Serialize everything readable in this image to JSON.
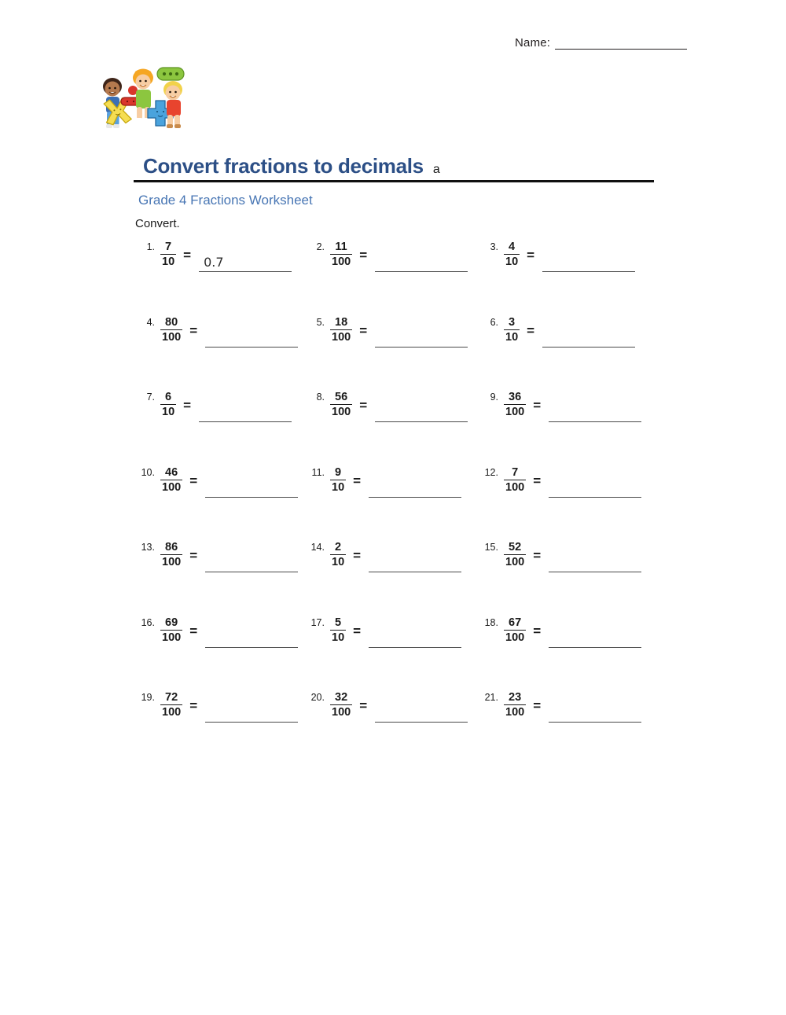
{
  "header": {
    "name_label": "Name:",
    "name_value": ""
  },
  "title": {
    "main": "Convert fractions to decimals",
    "variant": "a",
    "subtitle": "Grade 4 Fractions Worksheet",
    "instruction": "Convert.",
    "color_main": "#2c4f86",
    "color_subtitle": "#4876b4"
  },
  "clipart": {
    "name": "kids-with-math-symbols-clipart",
    "symbols": [
      "x",
      "-",
      "+",
      "÷"
    ],
    "colors": {
      "multiply": "#f2d644",
      "minus": "#d93b30",
      "plus": "#4aa3dd",
      "divide": "#7cc142"
    }
  },
  "problems": [
    {
      "number": "1.",
      "numerator": "7",
      "denominator": "10",
      "equals": "=",
      "answer": "0.7"
    },
    {
      "number": "2.",
      "numerator": "11",
      "denominator": "100",
      "equals": "=",
      "answer": ""
    },
    {
      "number": "3.",
      "numerator": "4",
      "denominator": "10",
      "equals": "=",
      "answer": ""
    },
    {
      "number": "4.",
      "numerator": "80",
      "denominator": "100",
      "equals": "=",
      "answer": ""
    },
    {
      "number": "5.",
      "numerator": "18",
      "denominator": "100",
      "equals": "=",
      "answer": ""
    },
    {
      "number": "6.",
      "numerator": "3",
      "denominator": "10",
      "equals": "=",
      "answer": ""
    },
    {
      "number": "7.",
      "numerator": "6",
      "denominator": "10",
      "equals": "=",
      "answer": ""
    },
    {
      "number": "8.",
      "numerator": "56",
      "denominator": "100",
      "equals": "=",
      "answer": ""
    },
    {
      "number": "9.",
      "numerator": "36",
      "denominator": "100",
      "equals": "=",
      "answer": ""
    },
    {
      "number": "10.",
      "numerator": "46",
      "denominator": "100",
      "equals": "=",
      "answer": ""
    },
    {
      "number": "11.",
      "numerator": "9",
      "denominator": "10",
      "equals": "=",
      "answer": ""
    },
    {
      "number": "12.",
      "numerator": "7",
      "denominator": "100",
      "equals": "=",
      "answer": ""
    },
    {
      "number": "13.",
      "numerator": "86",
      "denominator": "100",
      "equals": "=",
      "answer": ""
    },
    {
      "number": "14.",
      "numerator": "2",
      "denominator": "10",
      "equals": "=",
      "answer": ""
    },
    {
      "number": "15.",
      "numerator": "52",
      "denominator": "100",
      "equals": "=",
      "answer": ""
    },
    {
      "number": "16.",
      "numerator": "69",
      "denominator": "100",
      "equals": "=",
      "answer": ""
    },
    {
      "number": "17.",
      "numerator": "5",
      "denominator": "10",
      "equals": "=",
      "answer": ""
    },
    {
      "number": "18.",
      "numerator": "67",
      "denominator": "100",
      "equals": "=",
      "answer": ""
    },
    {
      "number": "19.",
      "numerator": "72",
      "denominator": "100",
      "equals": "=",
      "answer": ""
    },
    {
      "number": "20.",
      "numerator": "32",
      "denominator": "100",
      "equals": "=",
      "answer": ""
    },
    {
      "number": "21.",
      "numerator": "23",
      "denominator": "100",
      "equals": "=",
      "answer": ""
    }
  ]
}
